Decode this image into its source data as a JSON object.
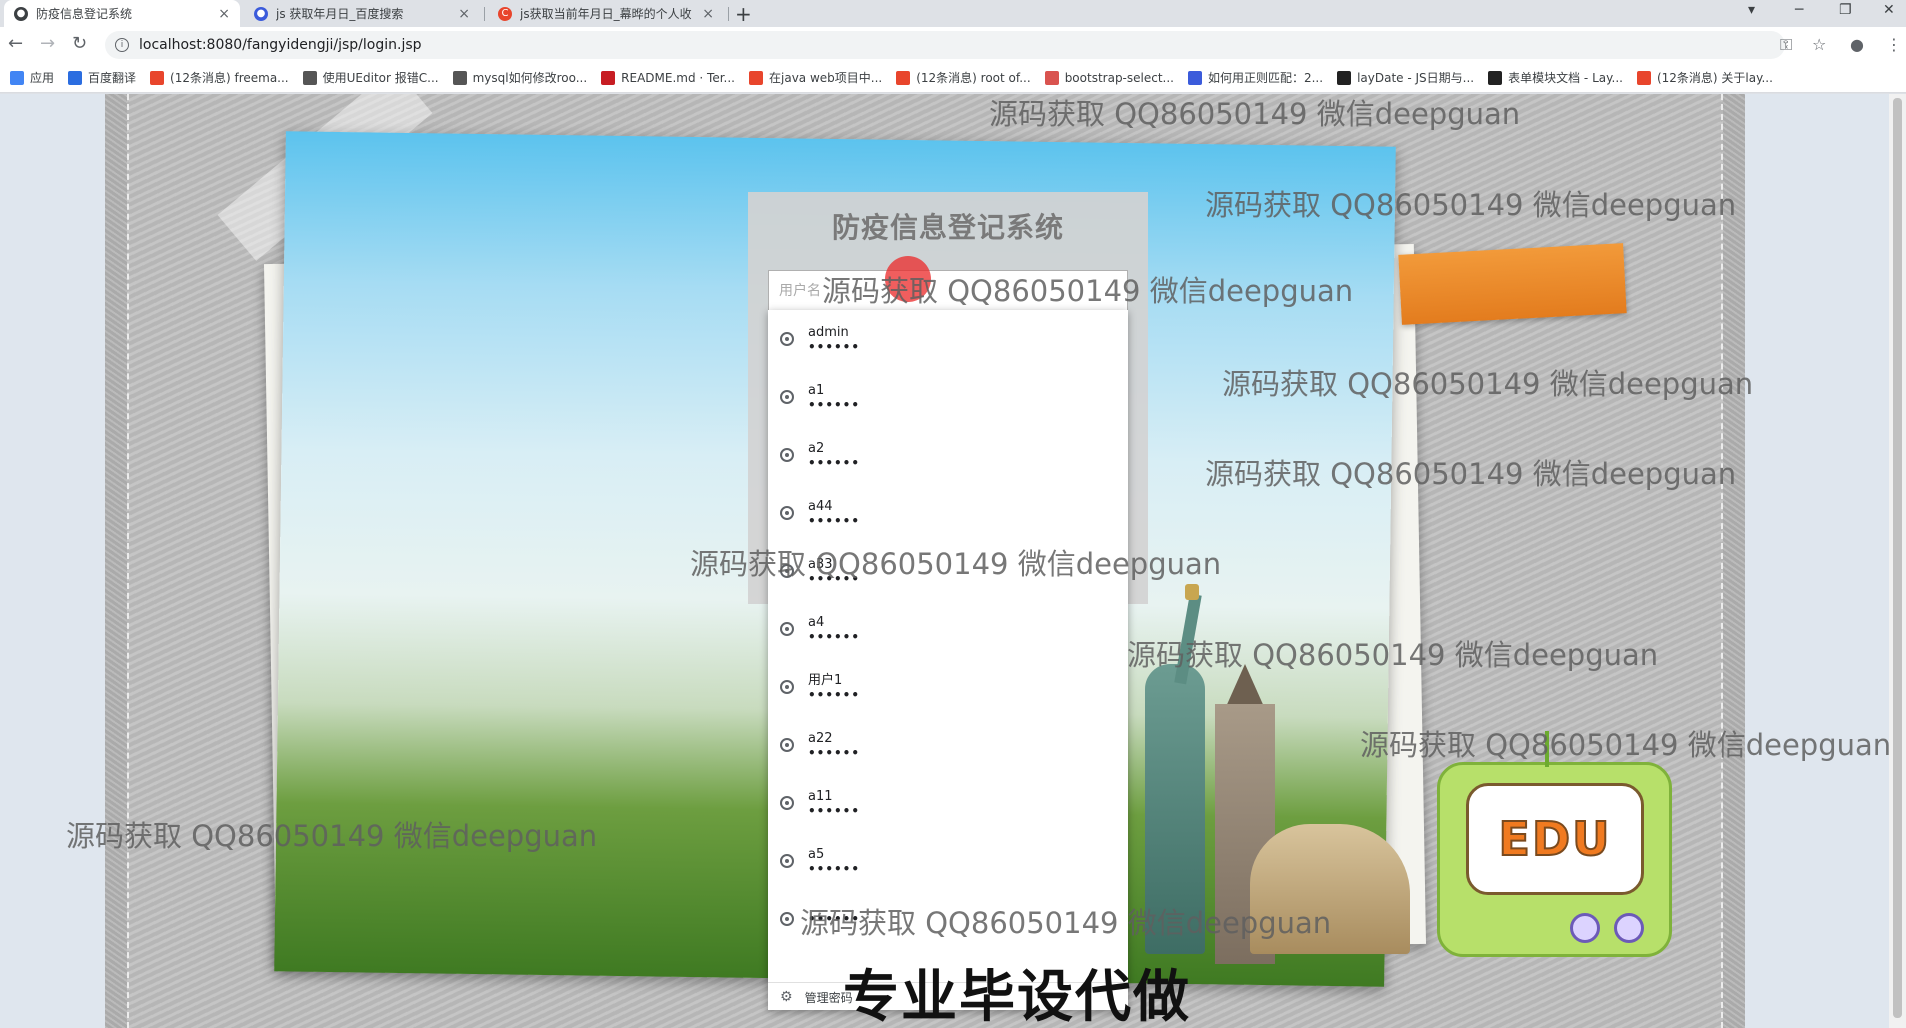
{
  "browser": {
    "tabs": [
      {
        "title": "防疫信息登记系统",
        "active": true,
        "favicon_color": "#3c4043"
      },
      {
        "title": "js 获取年月日_百度搜索",
        "active": false,
        "favicon_color": "#3b5bdb"
      },
      {
        "title": "js获取当前年月日_幕晔的个人收",
        "active": false,
        "favicon_color": "#e8452c"
      }
    ],
    "close_glyph": "×",
    "new_tab_glyph": "+",
    "url": "localhost:8080/fangyidengji/jsp/login.jsp",
    "bookmarks": [
      {
        "label": "应用",
        "icon": "apps-icon",
        "color": "#4285f4"
      },
      {
        "label": "百度翻译",
        "icon": "baidu-translate-icon",
        "color": "#2b6de0"
      },
      {
        "label": "(12条消息) freema...",
        "icon": "csdn-icon",
        "color": "#e8452c"
      },
      {
        "label": "使用UEditor 报错C...",
        "icon": "link-icon",
        "color": "#555555"
      },
      {
        "label": "mysql如何修改roo...",
        "icon": "link-icon",
        "color": "#555555"
      },
      {
        "label": "README.md · Ter...",
        "icon": "gitee-icon",
        "color": "#c71d23"
      },
      {
        "label": "在java web项目中...",
        "icon": "csdn-icon",
        "color": "#e8452c"
      },
      {
        "label": "(12条消息) root of...",
        "icon": "csdn-icon",
        "color": "#e8452c"
      },
      {
        "label": "bootstrap-select...",
        "icon": "cnblogs-icon",
        "color": "#d9534f"
      },
      {
        "label": "如何用正则匹配：2...",
        "icon": "baidu-icon",
        "color": "#3b5bdb"
      },
      {
        "label": "layDate - JS日期与...",
        "icon": "layui-icon",
        "color": "#222222"
      },
      {
        "label": "表单模块文档 - Lay...",
        "icon": "layui-icon",
        "color": "#222222"
      },
      {
        "label": "(12条消息) 关于lay...",
        "icon": "csdn-icon",
        "color": "#e8452c"
      }
    ]
  },
  "login": {
    "title": "防疫信息登记系统",
    "username_placeholder": "用户名"
  },
  "autofill": {
    "items": [
      {
        "username": "admin",
        "password": "••••••"
      },
      {
        "username": "a1",
        "password": "••••••"
      },
      {
        "username": "a2",
        "password": "••••••"
      },
      {
        "username": "a44",
        "password": "••••••"
      },
      {
        "username": "a33",
        "password": "••••••"
      },
      {
        "username": "a4",
        "password": "••••••"
      },
      {
        "username": "用户1",
        "password": "••••••"
      },
      {
        "username": "a22",
        "password": "••••••"
      },
      {
        "username": "a11",
        "password": "••••••"
      },
      {
        "username": "a5",
        "password": "••••••"
      },
      {
        "username": "",
        "password": "••••••"
      }
    ],
    "manage_label": "管理密码"
  },
  "edu_badge": "EDU",
  "watermark_text": "源码获取 QQ86050149 微信deepguan",
  "banner_text": "专业毕设代做",
  "colors": {
    "accent_orange": "#e37c1e",
    "cursor_highlight": "#eb2828"
  }
}
